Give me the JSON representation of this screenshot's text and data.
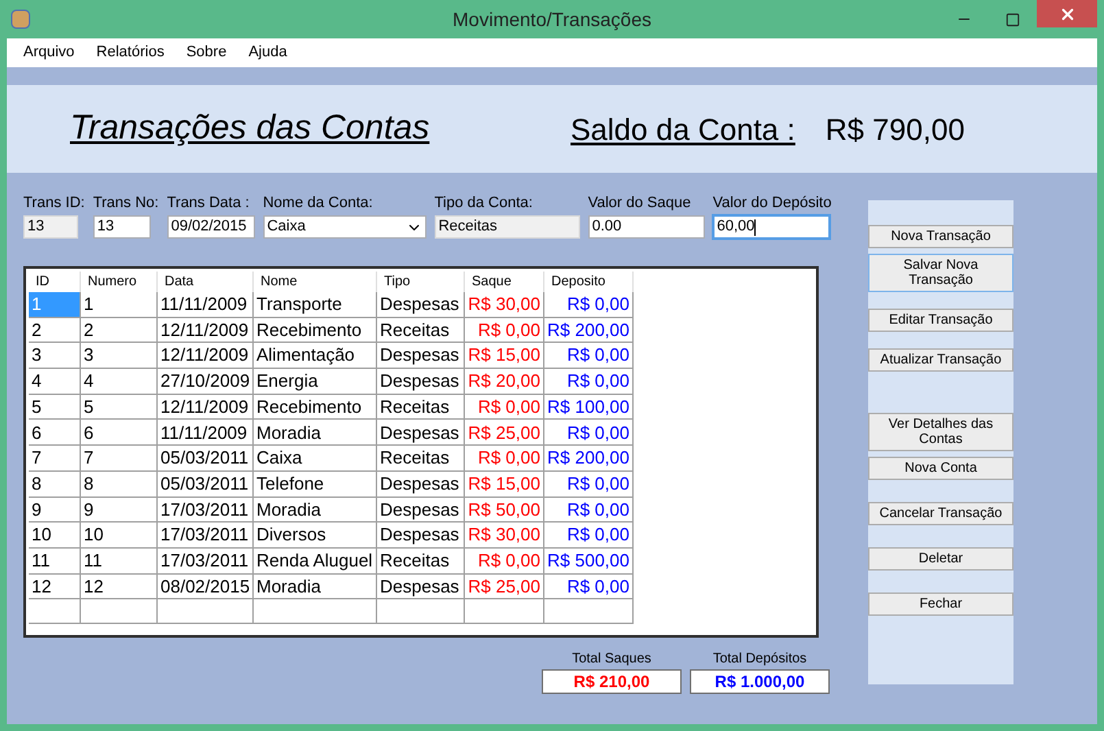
{
  "window": {
    "title": "Movimento/Transações"
  },
  "menu": [
    "Arquivo",
    "Relatórios",
    "Sobre",
    "Ajuda"
  ],
  "header": {
    "title": "Transações das Contas",
    "balance_label": "Saldo da Conta :",
    "balance_value": "R$ 790,00"
  },
  "fields": [
    {
      "label": "Trans ID:",
      "value": "13",
      "kind": "readonly",
      "focused": false
    },
    {
      "label": "Trans No:",
      "value": "13",
      "kind": "text",
      "focused": false
    },
    {
      "label": "Trans Data :",
      "value": "09/02/2015",
      "kind": "text",
      "focused": false
    },
    {
      "label": "Nome da Conta:",
      "value": "Caixa",
      "kind": "dropdown",
      "focused": false
    },
    {
      "label": "Tipo da Conta:",
      "value": "Receitas",
      "kind": "readonly",
      "focused": false
    },
    {
      "label": "Valor do Saque",
      "value": "0.00",
      "kind": "text",
      "focused": false
    },
    {
      "label": "Valor do Depósito",
      "value": "60,00",
      "kind": "text",
      "focused": true
    }
  ],
  "table": {
    "columns": [
      "ID",
      "Numero",
      "Data",
      "Nome",
      "Tipo",
      "Saque",
      "Deposito"
    ],
    "rows": [
      {
        "cells": [
          "1",
          "1",
          "11/11/2009",
          "Transporte",
          "Despesas",
          "R$ 30,00",
          "R$ 0,00"
        ],
        "selected": true
      },
      {
        "cells": [
          "2",
          "2",
          "12/11/2009",
          "Recebimento",
          "Receitas",
          "R$ 0,00",
          "R$ 200,00"
        ],
        "selected": false
      },
      {
        "cells": [
          "3",
          "3",
          "12/11/2009",
          "Alimentação",
          "Despesas",
          "R$ 15,00",
          "R$ 0,00"
        ],
        "selected": false
      },
      {
        "cells": [
          "4",
          "4",
          "27/10/2009",
          "Energia",
          "Despesas",
          "R$ 20,00",
          "R$ 0,00"
        ],
        "selected": false
      },
      {
        "cells": [
          "5",
          "5",
          "12/11/2009",
          "Recebimento",
          "Receitas",
          "R$ 0,00",
          "R$ 100,00"
        ],
        "selected": false
      },
      {
        "cells": [
          "6",
          "6",
          "11/11/2009",
          "Moradia",
          "Despesas",
          "R$ 25,00",
          "R$ 0,00"
        ],
        "selected": false
      },
      {
        "cells": [
          "7",
          "7",
          "05/03/2011",
          "Caixa",
          "Receitas",
          "R$ 0,00",
          "R$ 200,00"
        ],
        "selected": false
      },
      {
        "cells": [
          "8",
          "8",
          "05/03/2011",
          "Telefone",
          "Despesas",
          "R$ 15,00",
          "R$ 0,00"
        ],
        "selected": false
      },
      {
        "cells": [
          "9",
          "9",
          "17/03/2011",
          "Moradia",
          "Despesas",
          "R$ 50,00",
          "R$ 0,00"
        ],
        "selected": false
      },
      {
        "cells": [
          "10",
          "10",
          "17/03/2011",
          "Diversos",
          "Despesas",
          "R$ 30,00",
          "R$ 0,00"
        ],
        "selected": false
      },
      {
        "cells": [
          "11",
          "11",
          "17/03/2011",
          "Renda Aluguel",
          "Receitas",
          "R$ 0,00",
          "R$ 500,00"
        ],
        "selected": false
      },
      {
        "cells": [
          "12",
          "12",
          "08/02/2015",
          "Moradia",
          "Despesas",
          "R$ 25,00",
          "R$ 0,00"
        ],
        "selected": false
      }
    ]
  },
  "totals": [
    {
      "label": "Total Saques",
      "value": "R$ 210,00",
      "color": "#ff0000"
    },
    {
      "label": "Total Depósitos",
      "value": "R$ 1.000,00",
      "color": "#0000ff"
    }
  ],
  "buttons": [
    {
      "label": "Nova Transação",
      "focused": false
    },
    {
      "label": "Salvar Nova Transação",
      "focused": true
    },
    {
      "label": "Editar Transação",
      "focused": false
    },
    {
      "label": "Atualizar Transação",
      "focused": false
    },
    {
      "label": "Ver Detalhes das Contas",
      "focused": false
    },
    {
      "label": "Nova Conta",
      "focused": false
    },
    {
      "label": "Cancelar Transação",
      "focused": false
    },
    {
      "label": "Deletar",
      "focused": false
    },
    {
      "label": "Fechar",
      "focused": false
    }
  ]
}
